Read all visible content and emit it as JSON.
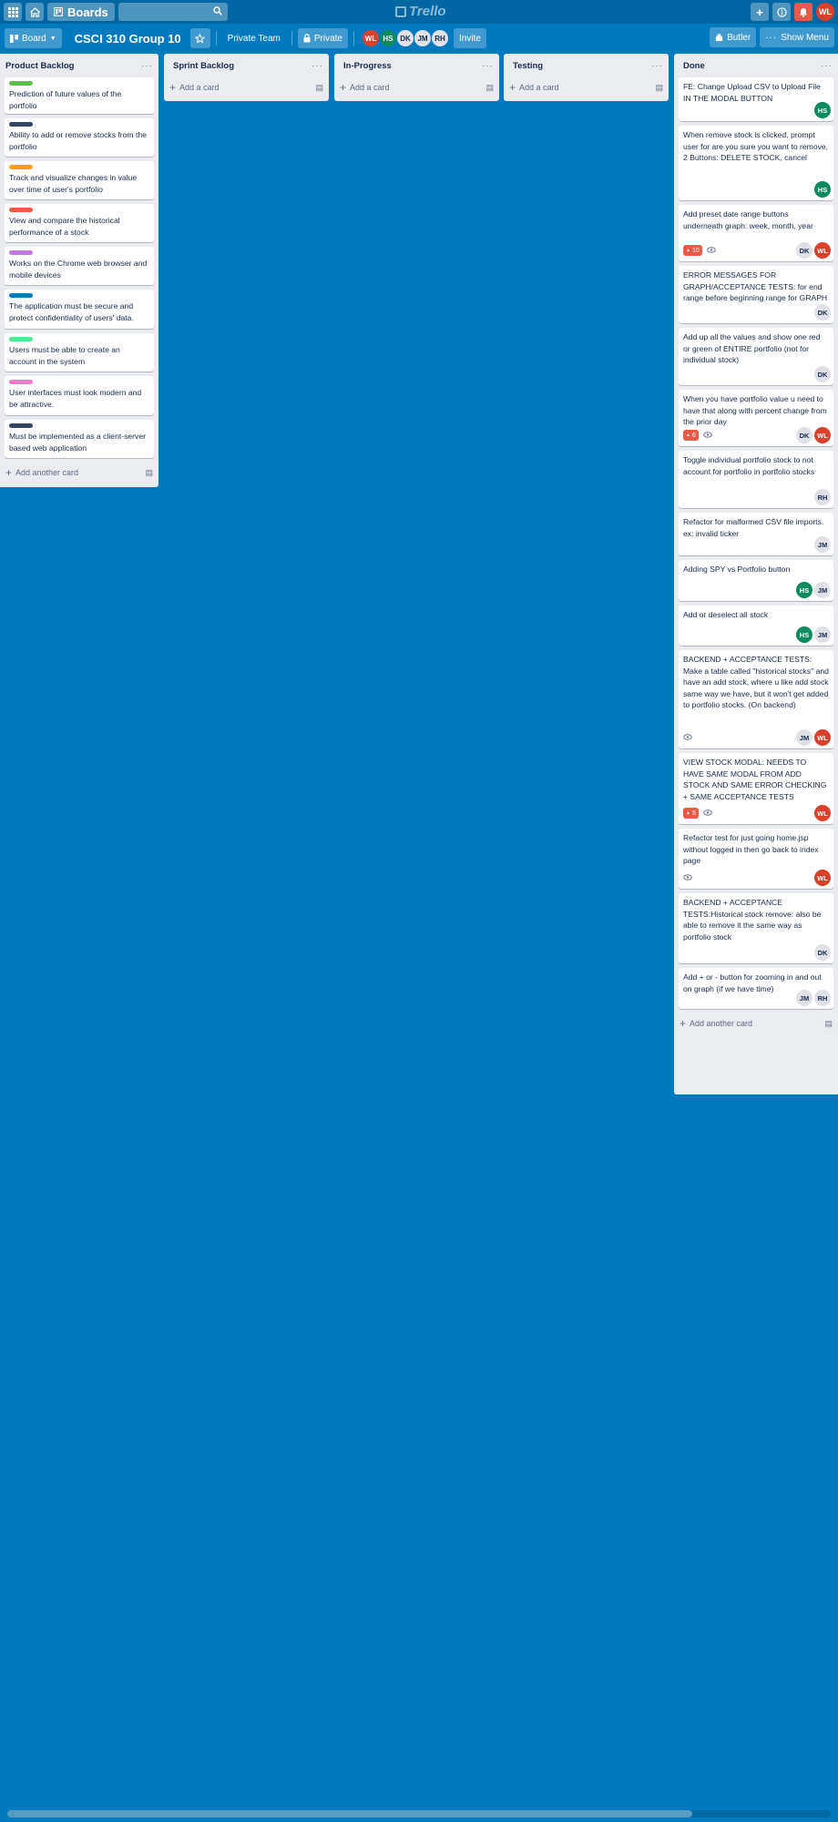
{
  "header": {
    "boards_label": "Boards",
    "search_placeholder": "",
    "logo": "Trello",
    "user_initials": "WL"
  },
  "board": {
    "view_label": "Board",
    "title": "CSCI 310 Group 10",
    "team_label": "Private Team",
    "visibility_label": "Private",
    "invite_label": "Invite",
    "butler_label": "Butler",
    "menu_label": "Show Menu",
    "members": [
      {
        "initials": "WL",
        "bg": "#d9412a",
        "fg": "#ffffff"
      },
      {
        "initials": "HS",
        "bg": "#0e8a5f",
        "fg": "#ffffff"
      },
      {
        "initials": "DK",
        "bg": "#dfe1e6",
        "fg": "#172b4d"
      },
      {
        "initials": "JM",
        "bg": "#dfe1e6",
        "fg": "#172b4d"
      },
      {
        "initials": "RH",
        "bg": "#dfe1e6",
        "fg": "#172b4d"
      }
    ]
  },
  "lists": [
    {
      "title": "Product Backlog",
      "add_label": "Add another card",
      "cards": [
        {
          "label_color": "#61bd4f",
          "text": "Prediction of future values of the portfolio"
        },
        {
          "label_color": "#344563",
          "text": "Ability to add or remove stocks from the portfolio"
        },
        {
          "label_color": "#ff9f1a",
          "text": "Track and visualize changes in value over time of user's portfolio"
        },
        {
          "label_color": "#eb5a46",
          "text": "View and compare the historical performance of a stock"
        },
        {
          "label_color": "#c377e0",
          "text": "Works on the Chrome web browser and mobile devices"
        },
        {
          "label_color": "#0079bf",
          "text": "The application must be secure and protect confidentiality of users' data."
        },
        {
          "label_color": "#51e898",
          "text": "Users must be able to create an account in the system"
        },
        {
          "label_color": "#ff78cb",
          "text": "User interfaces must look modern and be attractive."
        },
        {
          "label_color": "#344563",
          "text": "Must be implemented as a client-server based web application"
        }
      ]
    },
    {
      "title": "Sprint Backlog",
      "add_label": "Add a card",
      "cards": []
    },
    {
      "title": "In-Progress",
      "add_label": "Add a card",
      "cards": []
    },
    {
      "title": "Testing",
      "add_label": "Add a card",
      "cards": []
    },
    {
      "title": "Done",
      "add_label": "Add another card",
      "cards": [
        {
          "text": "FE: Change Upload CSV to Upload File IN THE MODAL BUTTON",
          "members": [
            "HS"
          ]
        },
        {
          "text": "When remove stock is clicked, prompt user for are you sure you want to remove, 2 Buttons: DELETE STOCK, cancel",
          "members": [
            "HS"
          ]
        },
        {
          "text": "Add preset date range buttons underneath graph: week, month, year",
          "badge": "10",
          "watch": true,
          "members": [
            "DK",
            "WL"
          ]
        },
        {
          "text": "ERROR MESSAGES FOR GRAPH/ACCEPTANCE TESTS: for end range before beginning range for GRAPH",
          "members": [
            "DK"
          ]
        },
        {
          "text": "Add up all the values and show one red or green of ENTIRE portfolio (not for individual stock)",
          "members": [
            "DK"
          ]
        },
        {
          "text": "When you have portfolio value u need to have that along with percent change from the prior day",
          "badge": "6",
          "watch": true,
          "members": [
            "DK",
            "WL"
          ]
        },
        {
          "text": "Toggle individual portfolio stock to not account for portfolio in portfolio stocks",
          "members": [
            "RH"
          ]
        },
        {
          "text": "Refactor for malformed CSV file imports. ex: invalid ticker",
          "members": [
            "JM"
          ]
        },
        {
          "text": "Adding SPY vs Portfolio button",
          "members": [
            "HS",
            "JM"
          ]
        },
        {
          "text": "Add or deselect all stock",
          "members": [
            "HS",
            "JM"
          ]
        },
        {
          "text": "BACKEND + ACCEPTANCE TESTS: Make a table called \"historical stocks\" and have an add stock, where u like add stock same way we have, but it won't get added to portfolio stocks. (On backend)",
          "watch": true,
          "members": [
            "JM",
            "WL"
          ]
        },
        {
          "text": "VIEW STOCK MODAL: NEEDS TO HAVE SAME MODAL FROM ADD STOCK AND SAME ERROR CHECKING + SAME ACCEPTANCE TESTS",
          "badge": "5",
          "watch": true,
          "members": [
            "WL"
          ]
        },
        {
          "text": "Refactor test for just going home.jsp without logged in then go back to index page",
          "watch": true,
          "members": [
            "WL"
          ]
        },
        {
          "text": "BACKEND + ACCEPTANCE TESTS:Historical stock remove: also be able to remove it the same way as portfolio stock",
          "members": [
            "DK"
          ]
        },
        {
          "text": "Add + or - button for zooming in and out on graph (if we have time)",
          "members": [
            "JM",
            "RH"
          ]
        }
      ]
    }
  ],
  "member_colors": {
    "WL": {
      "bg": "#d9412a",
      "fg": "#ffffff"
    },
    "HS": {
      "bg": "#0e8a5f",
      "fg": "#ffffff"
    },
    "DK": {
      "bg": "#dfe1e6",
      "fg": "#172b4d"
    },
    "JM": {
      "bg": "#dfe1e6",
      "fg": "#172b4d"
    },
    "RH": {
      "bg": "#dfe1e6",
      "fg": "#172b4d"
    }
  },
  "colors": {
    "board_bg": "#0079bf",
    "header_bg": "#0067a3",
    "list_bg": "#ebecf0",
    "badge_red": "#eb5a46"
  }
}
